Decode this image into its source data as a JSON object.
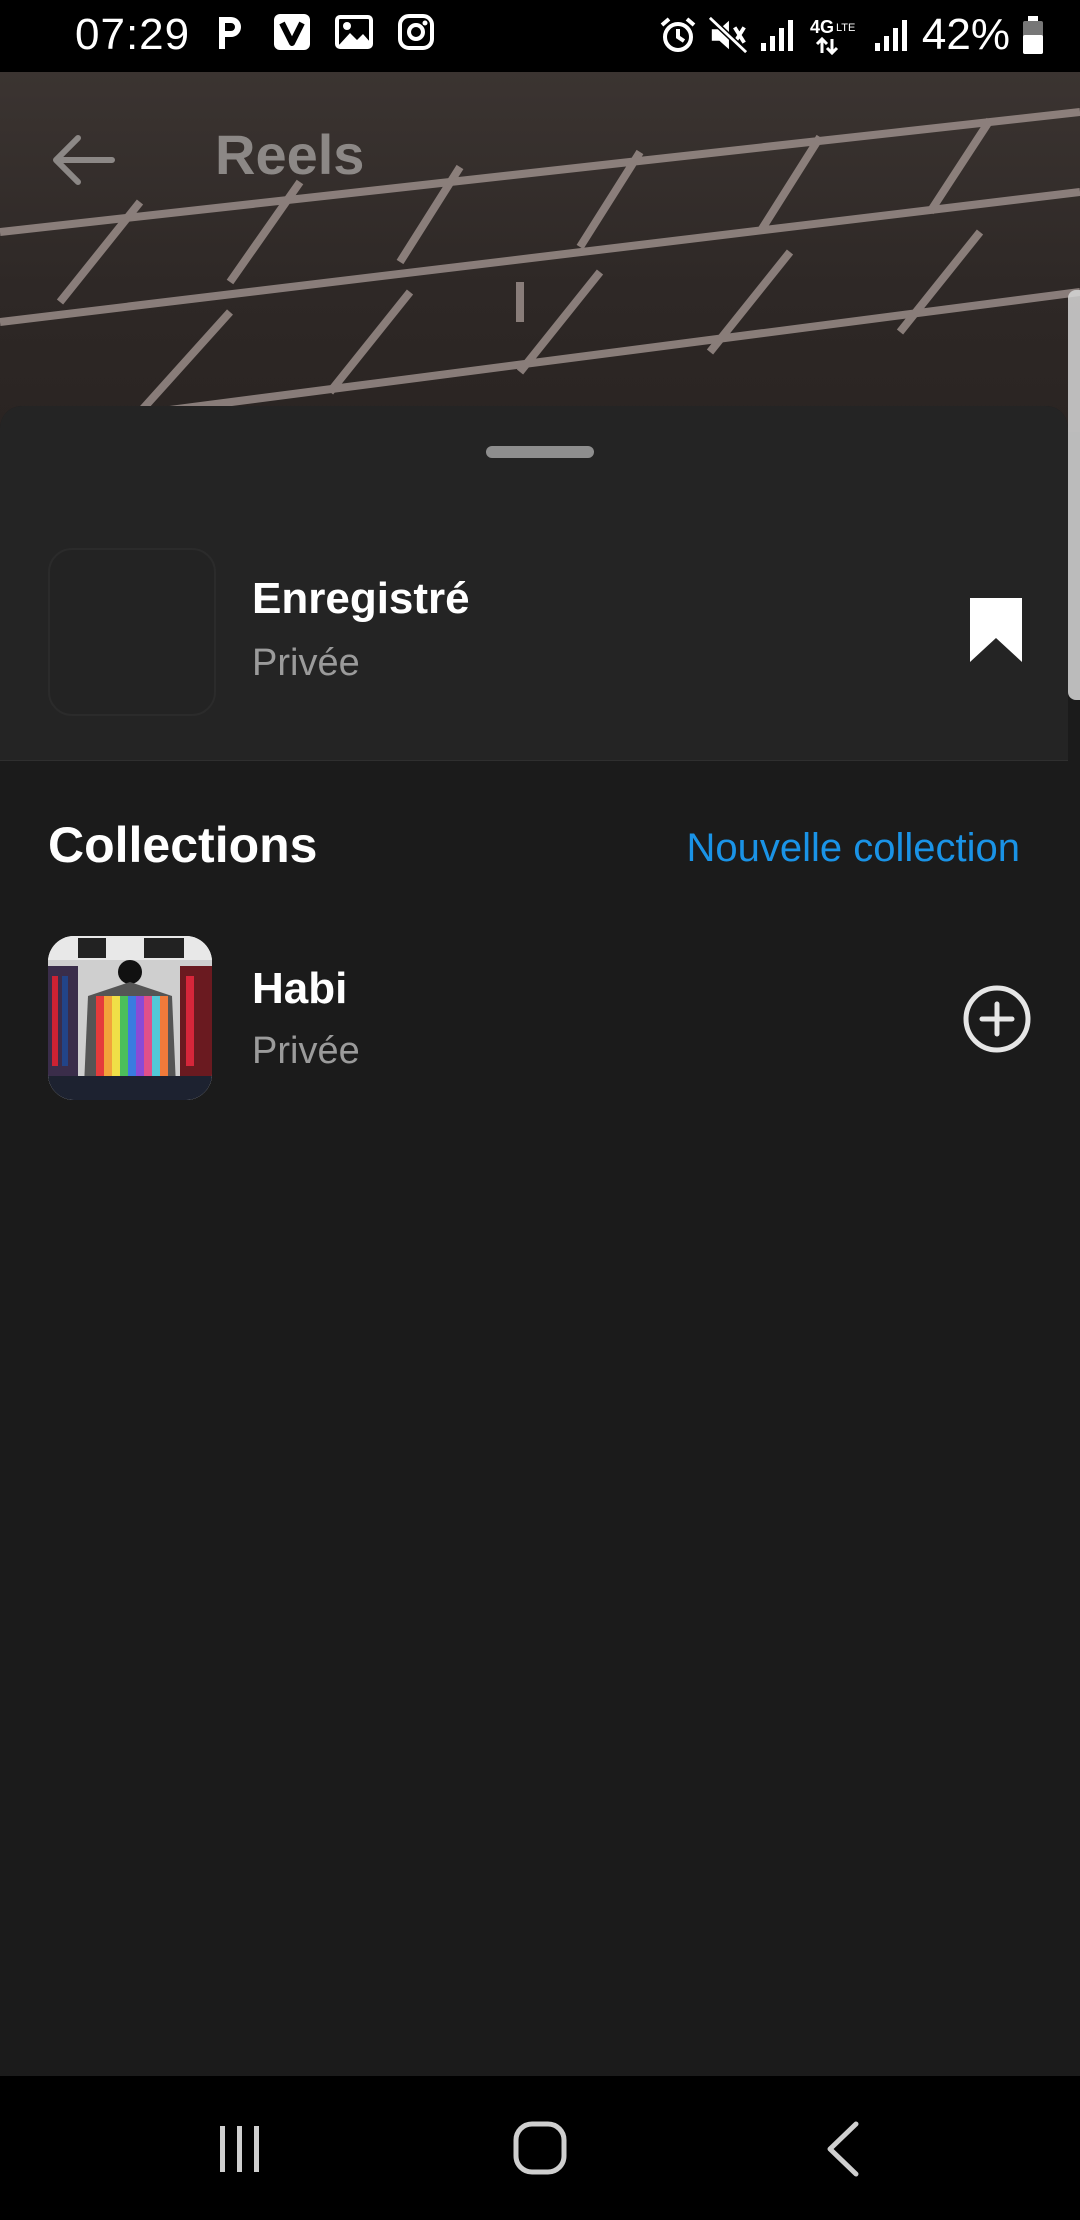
{
  "status_bar": {
    "time": "07:29",
    "left_icons": [
      "parking-p-icon",
      "viber-v-icon",
      "gallery-image-icon",
      "instagram-icon"
    ],
    "right_icons": [
      "alarm-icon",
      "mute-vibrate-icon",
      "signal-icon",
      "4g-lte-icon",
      "signal-icon"
    ],
    "network_label": "4G LTE",
    "battery": "42%"
  },
  "header": {
    "title": "Reels",
    "back_icon": "back-arrow-icon"
  },
  "sheet": {
    "saved": {
      "title": "Enregistré",
      "subtitle": "Privée",
      "icon": "bookmark-icon"
    },
    "collections_title": "Collections",
    "new_collection_label": "Nouvelle collection",
    "items": [
      {
        "title": "Habi",
        "subtitle": "Privée",
        "action_icon": "add-circle-icon"
      }
    ]
  },
  "nav_bar": {
    "buttons": [
      "recent-apps-icon",
      "home-icon",
      "back-icon"
    ]
  },
  "colors": {
    "accent": "#1a93e6",
    "sheet_bg": "#1b1b1b",
    "sheet_top_bg": "#242424",
    "muted_text": "#9b9b9b"
  }
}
